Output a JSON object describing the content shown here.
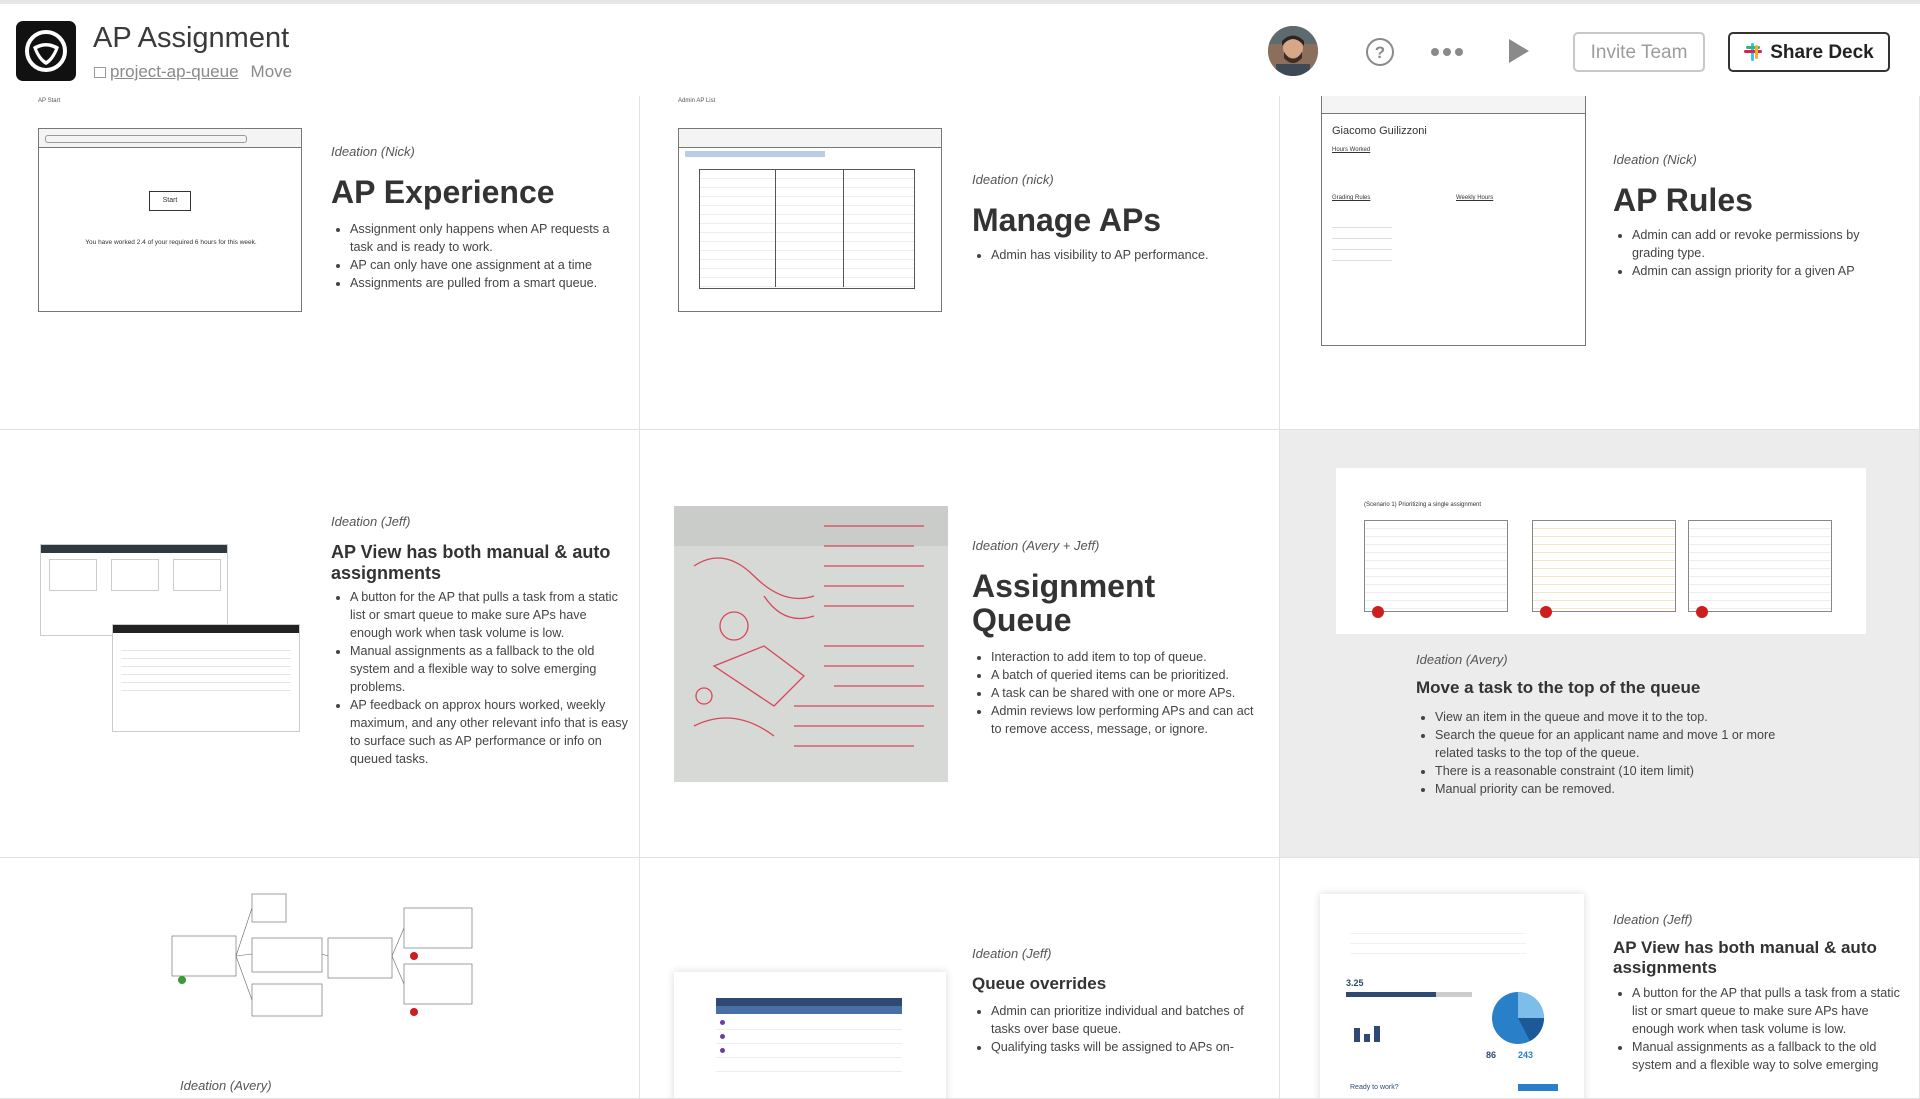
{
  "header": {
    "title": "AP Assignment",
    "project_link": "project-ap-queue",
    "move_label": "Move",
    "invite_label": "Invite Team",
    "share_label": "Share Deck",
    "icons": [
      "help-icon",
      "more-icon",
      "play-icon",
      "slack-icon"
    ]
  },
  "cards": [
    {
      "label": "Ideation (Nick)",
      "heading": "AP Experience",
      "bullets": [
        "Assignment only happens when AP requests a task and is ready to work.",
        "AP can only have one assignment at a time",
        "Assignments are pulled from a smart queue."
      ],
      "thumb_title": "AP Start",
      "thumb_button": "Start",
      "thumb_text": "You have worked 2.4 of your required 6 hours for this week."
    },
    {
      "label": "Ideation (nick)",
      "heading": "Manage APs",
      "bullets": [
        "Admin has visibility to AP performance."
      ],
      "thumb_title": "Admin AP List"
    },
    {
      "label": "Ideation (Nick)",
      "heading": "AP Rules",
      "bullets": [
        "Admin can add or revoke permissions by grading type.",
        "Admin can assign priority for a given AP"
      ],
      "thumb_name": "Giacomo Guilizzoni",
      "thumb_hours": "Hours Worked",
      "thumb_rules": "Grading Rules",
      "thumb_weekly": "Weekly Hours"
    },
    {
      "label": "Ideation (Jeff)",
      "heading": "AP View has both manual & auto assignments",
      "bullets": [
        "A button for the AP that pulls a task from a static list or smart queue to make sure APs have enough work when task volume is low.",
        "Manual assignments as a fallback to the old system and a flexible way to solve emerging problems.",
        "AP feedback on approx hours worked, weekly maximum, and any other relevant info that is easy to surface such as AP performance or info on queued tasks."
      ]
    },
    {
      "label": "Ideation (Avery + Jeff)",
      "heading": "Assignment Queue",
      "bullets": [
        "Interaction to add item to top of queue.",
        "A batch of queried items can be prioritized.",
        "A task can be shared with one or more APs.",
        "Admin reviews low performing APs and can act to remove access, message, or ignore."
      ]
    },
    {
      "label": "Ideation (Avery)",
      "heading": "Move a task to the top of the queue",
      "bullets": [
        "View an item in the queue and move it to the top.",
        "Search the queue for an applicant name and move 1 or more related tasks to the top of the queue.",
        "There is a reasonable constraint (10 item limit)",
        "Manual priority can be removed."
      ],
      "thumb_title": "(Scenario 1) Prioritizing a single assignment"
    },
    {
      "label": "Ideation (Avery)"
    },
    {
      "label": "Ideation (Jeff)",
      "heading": "Queue overrides",
      "bullets": [
        "Admin can prioritize individual and batches of tasks over base queue.",
        "Qualifying tasks will be assigned to APs on-"
      ]
    },
    {
      "label": "Ideation (Jeff)",
      "heading": "AP View has both manual & auto assignments",
      "bullets": [
        "A button for the AP that pulls a task from a static list or smart queue to make sure APs have enough work when task volume is low.",
        "Manual assignments as a fallback to the old system and a flexible way to solve emerging"
      ],
      "thumb_value": "3.25",
      "thumb_stat1": "86",
      "thumb_stat2": "243",
      "thumb_cta": "Ready to work?"
    }
  ]
}
